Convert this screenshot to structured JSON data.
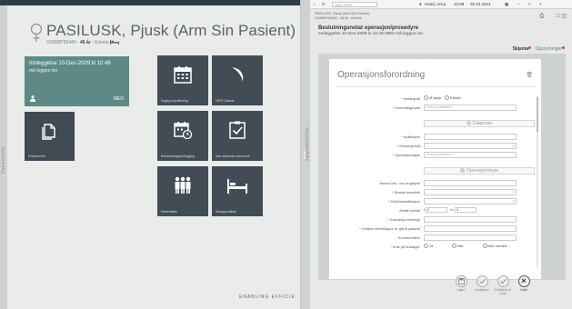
{
  "left": {
    "rail_label": "Pasientlister",
    "patient": {
      "name": "PASILUSK, Pjusk (Arm Sin Pasient)",
      "id": "010868*26440",
      "age": "46 år",
      "sex": "Kvinne"
    },
    "admission_tile": {
      "title": "Innleggelse 10-Des-2009 kl 10:48",
      "subtitle": "må legges inn",
      "unit": "MED"
    },
    "tiles": [
      {
        "label": "Dokumenter"
      },
      {
        "label": "Daglig koordinering"
      },
      {
        "label": "DIPS Classic"
      },
      {
        "label": "Behandlingsplanlegging"
      },
      {
        "label": "Ikke sjekkede prøvesvar"
      },
      {
        "label": "Pasientliste"
      },
      {
        "label": "Sengepostliste"
      }
    ],
    "brand": "ENABLING EFFICIE"
  },
  "divider": {
    "label": "Skjul pasientliste"
  },
  "right": {
    "topbar": {
      "search_placeholder": "Søk i DIPS",
      "user": "Heed, Arica",
      "time": "12:09",
      "date": "26.10.2014"
    },
    "patient_line1": "PASILUSK, Pjusk (Arm Sin Pasient)",
    "patient_line2": "010868*26440 - 46 år - Kvinne",
    "title": "Beslutningsnotat operasjon/prosedyre",
    "subtitle": "Innleggelse 10-Des-2009 kl 10:48 MED må legges inn",
    "tabs": {
      "skjema": "Skjema",
      "opplysninger": "Opplysninger"
    },
    "form": {
      "title": "Operasjonsforordning",
      "hastegrad_label": "Hastegrad",
      "hastegrad_options": [
        "Ø-hjelp",
        "Elektiv"
      ],
      "hoveddiagnose_label": "Hoveddiagnose",
      "hoveddiagnose_placeholder": "Skriv inn søketekst",
      "section_diagnose": "Diagnose",
      "indikasjon_label": "Indikasjon",
      "omsorgsniva_label": "Omsorgsnivå",
      "operasjonstype_label": "Operasjonstype",
      "operasjonstype_placeholder": "Skriv inn søketekst",
      "section_operasjonstype": "Operasjonstype",
      "annen_info_label": "Annen info. om inngrepet",
      "onsket_anestesi_label": "Ønsket anestesi",
      "asa_label": "ASA klassifikasjon",
      "antatt_knivtid_label": "Antatt knivtid",
      "knivtid_t": "t",
      "knivtid_t_value": "0",
      "knivtid_m": "m",
      "knivtid_m_value": "0",
      "ansvarlig_label": "Ansvarlig overlege",
      "informasjon_label": "Hvilken informasjon er gitt til pasient",
      "kommentarer_label": "Kommentarer",
      "krav_label": "Krav på ledsager",
      "krav_options": [
        "Ja",
        "Nei",
        "Ikke vurdert"
      ]
    },
    "buttons": [
      {
        "label": "Lagre"
      },
      {
        "label": "Godkjenn"
      },
      {
        "label": "Godkjenn & Lukk"
      },
      {
        "label": "Lukk"
      }
    ]
  }
}
